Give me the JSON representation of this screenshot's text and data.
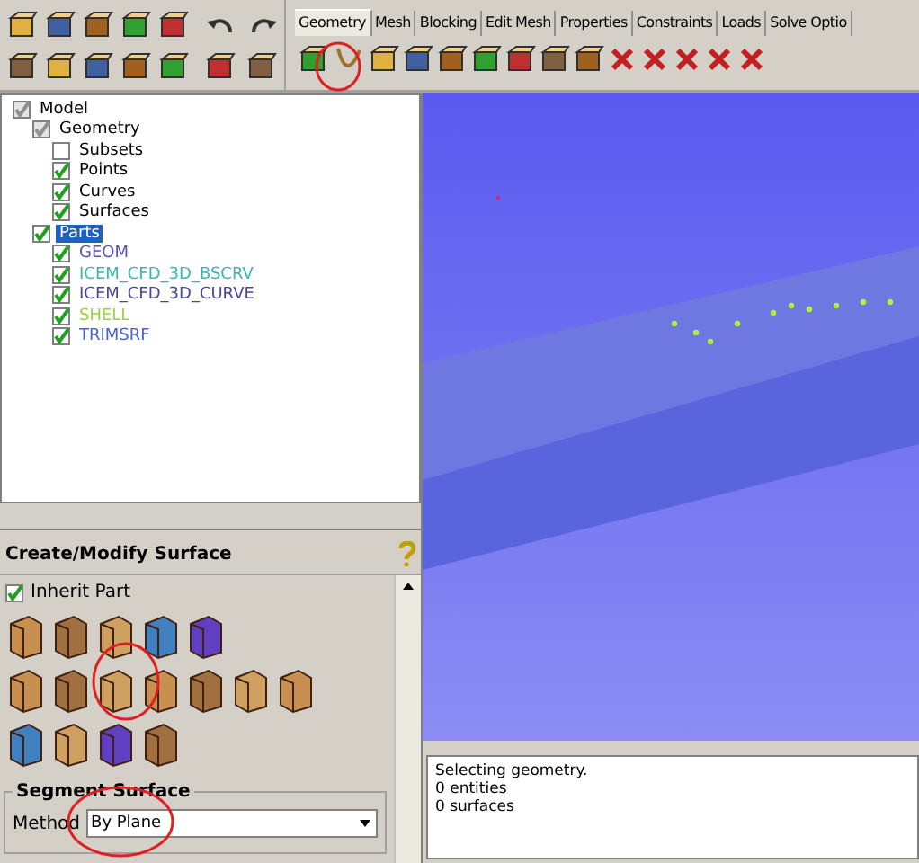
{
  "tabs": [
    {
      "label": "Geometry",
      "selected": true
    },
    {
      "label": "Mesh",
      "selected": false
    },
    {
      "label": "Blocking",
      "selected": false
    },
    {
      "label": "Edit Mesh",
      "selected": false
    },
    {
      "label": "Properties",
      "selected": false
    },
    {
      "label": "Constraints",
      "selected": false
    },
    {
      "label": "Loads",
      "selected": false
    },
    {
      "label": "Solve Optio",
      "selected": false
    }
  ],
  "tree": [
    {
      "label": "Model",
      "checked": true,
      "partial": true,
      "selected": false,
      "children": [
        {
          "label": "Geometry",
          "checked": true,
          "partial": true,
          "selected": false,
          "children": [
            {
              "label": "Subsets",
              "checked": false,
              "partial": false,
              "selected": false
            },
            {
              "label": "Points",
              "checked": true,
              "partial": false,
              "selected": false
            },
            {
              "label": "Curves",
              "checked": true,
              "partial": false,
              "selected": false
            },
            {
              "label": "Surfaces",
              "checked": true,
              "partial": false,
              "selected": false
            }
          ]
        },
        {
          "label": "Parts",
          "checked": true,
          "partial": false,
          "selected": true,
          "children": [
            {
              "label": "GEOM",
              "checked": true,
              "partial": false,
              "selected": false,
              "color": "#5a50b4"
            },
            {
              "label": "ICEM_CFD_3D_BSCRV",
              "checked": true,
              "partial": false,
              "selected": false,
              "color": "#3cb4b4"
            },
            {
              "label": "ICEM_CFD_3D_CURVE",
              "checked": true,
              "partial": false,
              "selected": false,
              "color": "#4646a0"
            },
            {
              "label": "SHELL",
              "checked": true,
              "partial": false,
              "selected": false,
              "color": "#a0d23c"
            },
            {
              "label": "TRIMSRF",
              "checked": true,
              "partial": false,
              "selected": false,
              "color": "#4664c8"
            }
          ]
        }
      ]
    }
  ],
  "panel": {
    "title": "Create/Modify Surface",
    "inherit": {
      "label": "Inherit Part",
      "checked": true
    },
    "group": "Segment Surface",
    "method_label": "Method",
    "method_value": "By Plane"
  },
  "messages": [
    "Selecting geometry.",
    "0 entities",
    "0 surfaces"
  ]
}
